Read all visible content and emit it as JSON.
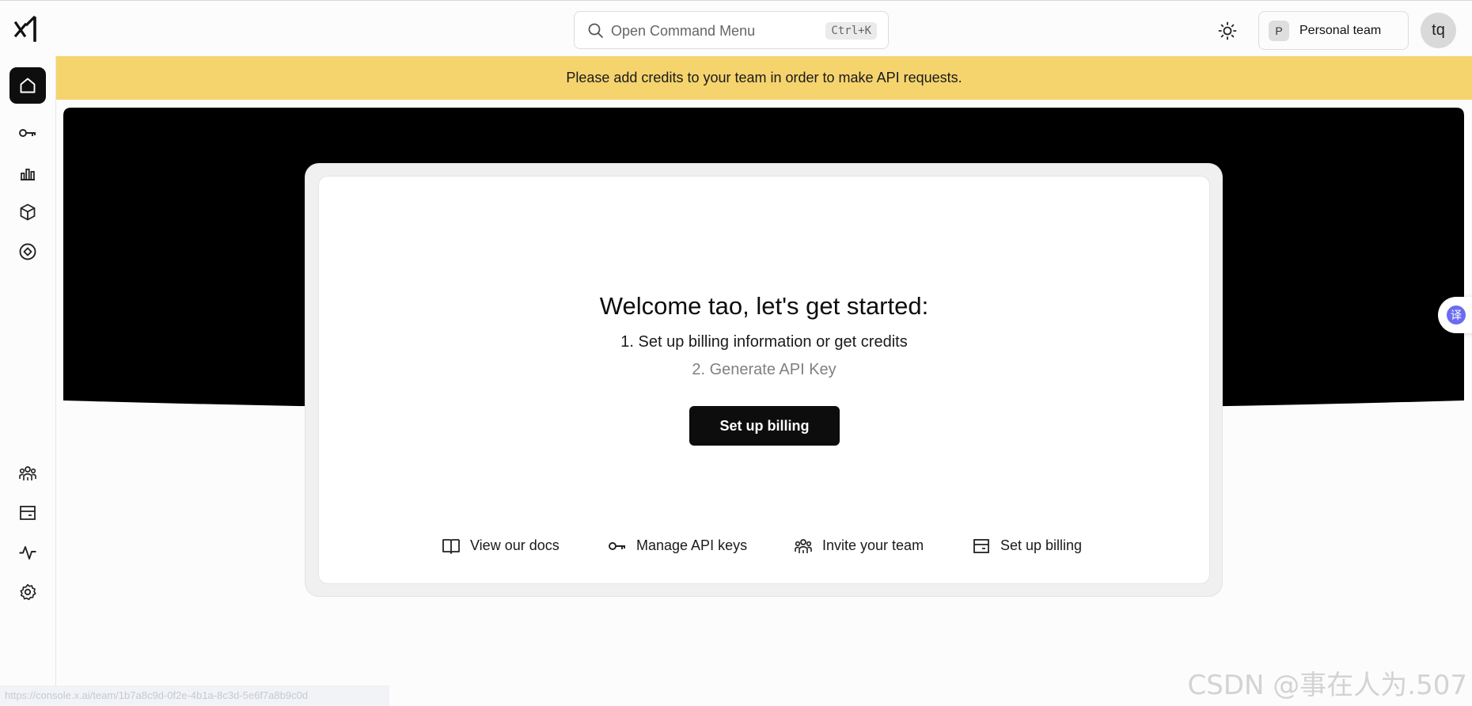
{
  "header": {
    "search": {
      "placeholder": "Open Command Menu",
      "shortcut": "Ctrl+K"
    },
    "team": {
      "badge": "P",
      "name": "Personal team"
    },
    "avatar": "tq"
  },
  "sidebar": {
    "top_items": [
      {
        "icon": "home-icon",
        "active": true
      },
      {
        "icon": "key-icon",
        "active": false
      },
      {
        "icon": "bar-chart-icon",
        "active": false
      },
      {
        "icon": "cube-icon",
        "active": false
      },
      {
        "icon": "target-icon",
        "active": false
      }
    ],
    "bottom_items": [
      {
        "icon": "team-icon"
      },
      {
        "icon": "billing-icon"
      },
      {
        "icon": "activity-icon"
      },
      {
        "icon": "settings-gear-icon"
      }
    ]
  },
  "banner": {
    "text": "Please add credits to your team in order to make API requests."
  },
  "welcome": {
    "title": "Welcome tao, let's get started:",
    "step1": "1. Set up billing information or get credits",
    "step2": "2. Generate API Key",
    "cta": "Set up billing"
  },
  "quick_links": [
    {
      "icon": "book-icon",
      "label": "View our docs"
    },
    {
      "icon": "key-icon",
      "label": "Manage API keys"
    },
    {
      "icon": "team-icon",
      "label": "Invite your team"
    },
    {
      "icon": "billing-icon",
      "label": "Set up billing"
    }
  ],
  "translate_button": {
    "glyph": "译"
  },
  "status_url": "https://console.x.ai/team/1b7a8c9d-0f2e-4b1a-8c3d-5e6f7a8b9c0d",
  "watermark": "CSDN @事在人为.507",
  "colors": {
    "banner": "#f5d46e",
    "primary": "#0d0d0d",
    "translate": "#6a6cf0"
  }
}
